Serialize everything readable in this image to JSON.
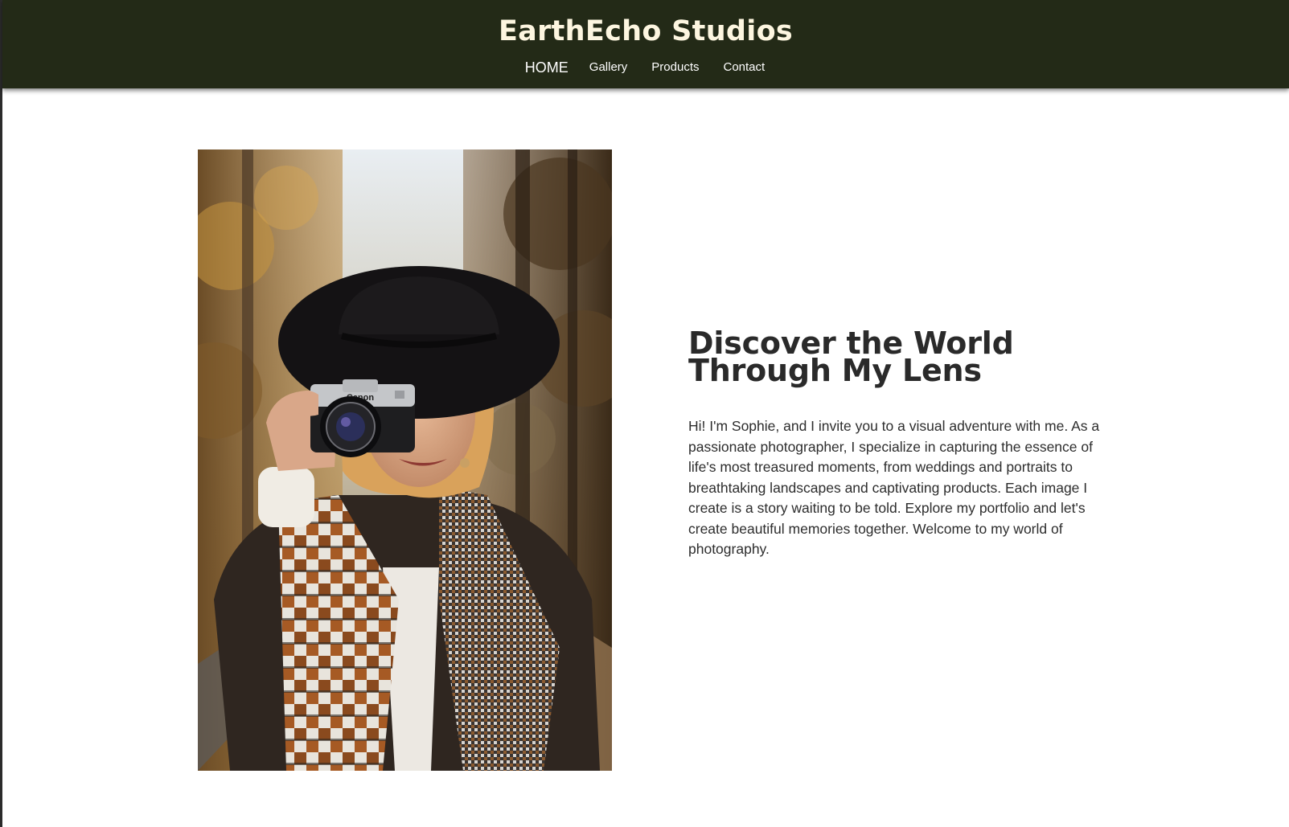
{
  "header": {
    "brand": "EarthEcho Studios",
    "background_color": "#232a17",
    "nav": [
      {
        "label": "HOME",
        "active": true
      },
      {
        "label": "Gallery",
        "active": false
      },
      {
        "label": "Products",
        "active": false
      },
      {
        "label": "Contact",
        "active": false
      }
    ]
  },
  "hero": {
    "title": "Discover the World Through My Lens",
    "body": "Hi! I'm Sophie, and I invite you to a visual adventure with me. As a passionate photographer, I specialize in capturing the essence of life's most treasured moments, from weddings and portraits to breathtaking landscapes and captivating products. Each image I create is a story waiting to be told. Explore my portfolio and let's create beautiful memories together. Welcome to my world of photography.",
    "photo": {
      "camera_brand_text": "Canon"
    }
  }
}
